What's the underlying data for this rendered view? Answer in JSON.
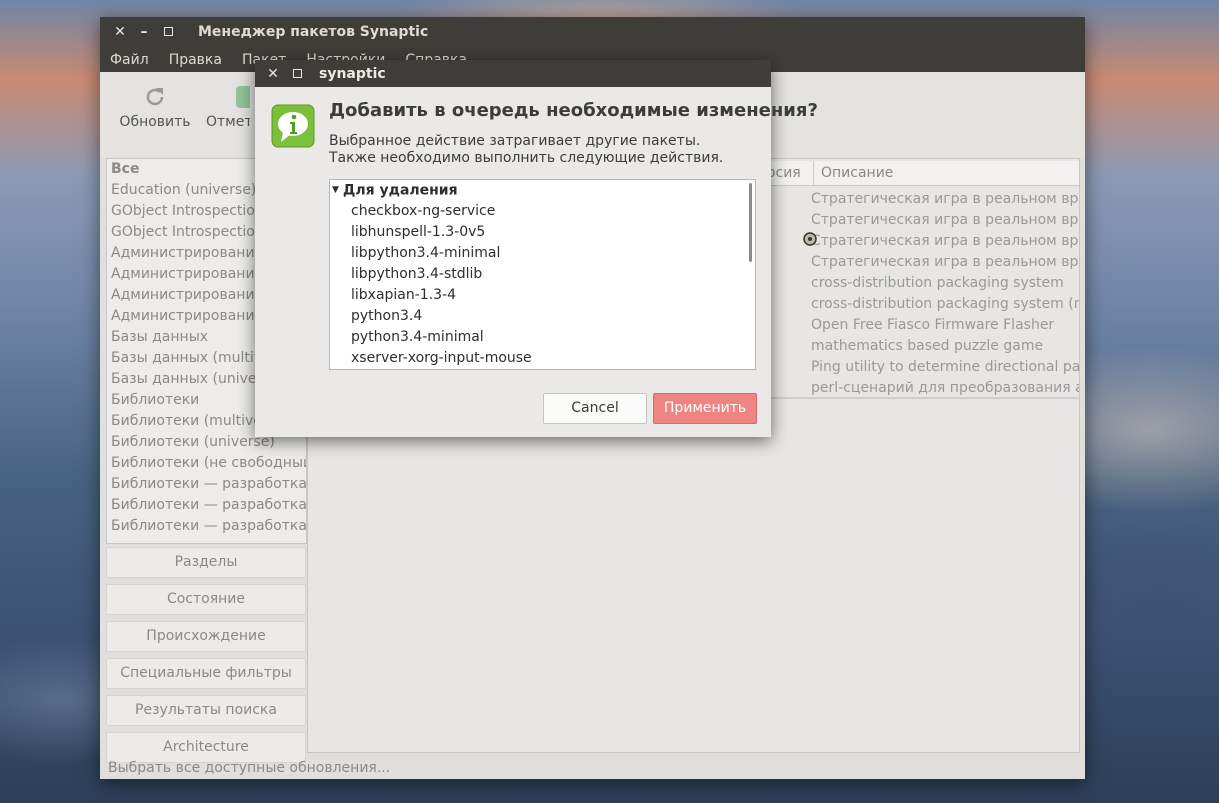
{
  "main_window": {
    "title": "Менеджер пакетов Synaptic",
    "menu": [
      "Файл",
      "Правка",
      "Пакет",
      "Настройки",
      "Справка"
    ],
    "toolbar": {
      "reload_label": "Обновить",
      "mark_label": "Отмети"
    },
    "categories": [
      "Все",
      "Education (universe)",
      "GObject Introspection",
      "GObject Introspection",
      "Администрирование",
      "Администрирование",
      "Администрирование",
      "Администрирование",
      "Базы данных",
      "Базы данных (multive",
      "Базы данных (univer",
      "Библиотеки",
      "Библиотеки (multive",
      "Библиотеки (universe)",
      "Библиотеки (не свободный",
      "Библиотеки — разработка",
      "Библиотеки — разработка (",
      "Библиотеки — разработка ("
    ],
    "filter_buttons": [
      "Разделы",
      "Состояние",
      "Происхождение",
      "Специальные фильтры",
      "Результаты поиска",
      "Architecture"
    ],
    "table": {
      "columns": {
        "version": "ерсия",
        "description": "Описание"
      },
      "descriptions": [
        "Стратегическая игра в реальном время",
        "Стратегическая игра в реальном время",
        "Стратегическая игра в реальном время",
        "Стратегическая игра в реальном время",
        "cross-distribution packaging system",
        "cross-distribution packaging system (no",
        "Open Free Fiasco Firmware Flasher",
        "mathematics based puzzle game",
        "Ping utility to determine directional pack",
        "perl-сценарий для преобразования ад"
      ]
    },
    "status_text": "Выбрать все доступные обновления..."
  },
  "dialog": {
    "title": "synaptic",
    "heading": "Добавить в очередь необходимые изменения?",
    "body": "Выбранное действие затрагивает другие пакеты. Также необходимо выполнить следующие действия.",
    "group_label": "Для удаления",
    "packages": [
      "checkbox-ng-service",
      "libhunspell-1.3-0v5",
      "libpython3.4-minimal",
      "libpython3.4-stdlib",
      "libxapian-1.3-4",
      "python3.4",
      "python3.4-minimal",
      "xserver-xorg-input-mouse"
    ],
    "cancel_label": "Cancel",
    "apply_label": "Применить"
  },
  "colors": {
    "titlebar": "#3e3d39",
    "apply_button": "#ef8582",
    "info_icon": "#7cbf3a"
  }
}
